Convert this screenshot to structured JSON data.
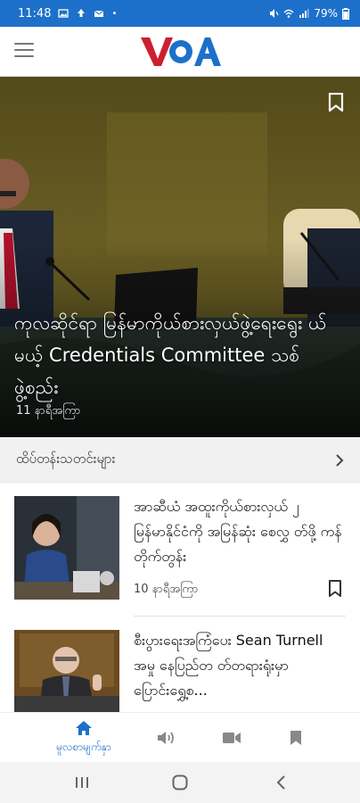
{
  "status_bar": {
    "time": "11:48",
    "battery": "79%"
  },
  "header": {
    "logo_text": "VOA",
    "menu_icon": "hamburger-menu-icon"
  },
  "hero": {
    "title": "ကုလဆိုင်ရာ မြန်မာကိုယ်စားလှယ်ဖွဲ့ရေးရွေး ယ်မယ့် Credentials Committee သစ် ဖွဲ့စည်း",
    "time": "11 နာရီအကြာ"
  },
  "section": {
    "label": "ထိပ်တန်းသတင်းများ"
  },
  "articles": [
    {
      "headline": "အာဆီယံ အထူးကိုယ်စားလှယ် ၂ မြန်မာနိုင်ငံကို အမြန်ဆုံး စေလွှ တ်ဖို့ ကန် တိုက်တွန်း",
      "time": "10 နာရီအကြာ"
    },
    {
      "headline": "စီးပွားရေးအကြံပေး Sean Turnell အမှု နေပြည်တ တ်တရားရုံးမှာ ပြောင်းရွှေ့စ..."
    }
  ],
  "bottom_nav": {
    "home_label": "မူလစာမျက်နှာ"
  },
  "colors": {
    "brand_blue": "#1d70c9",
    "logo_red": "#cc1f2f",
    "logo_blue": "#1d70c9"
  }
}
